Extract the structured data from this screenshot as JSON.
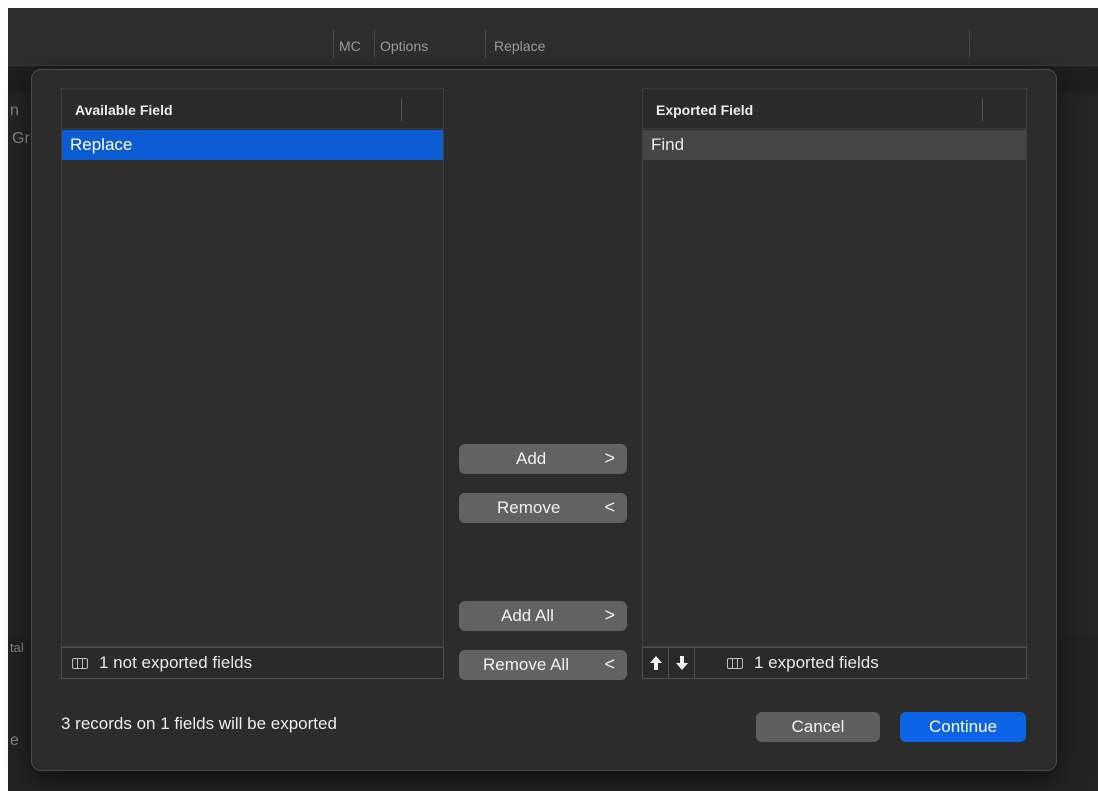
{
  "background": {
    "toolbar_labels": [
      "MC",
      "Options",
      "Replace"
    ],
    "side_fragments": [
      "n",
      "Gr",
      "tal",
      "e"
    ]
  },
  "dialog": {
    "available": {
      "header": "Available Field",
      "rows": [
        "Replace"
      ],
      "footer": "1 not exported fields"
    },
    "exported": {
      "header": "Exported Field",
      "rows": [
        "Find"
      ],
      "footer": "1 exported fields"
    },
    "buttons": {
      "add": "Add",
      "remove": "Remove",
      "add_all": "Add All",
      "remove_all": "Remove All",
      "cancel": "Cancel",
      "continue": "Continue"
    },
    "chevrons": {
      "right": ">",
      "left": "<"
    },
    "status": "3 records on 1 fields will be exported"
  },
  "colors": {
    "selection": "#0b5bd3",
    "primary_button": "#0b63e6"
  },
  "icons": [
    "columns-icon",
    "arrow-up-icon",
    "arrow-down-icon",
    "chevron-right-icon",
    "chevron-left-icon"
  ]
}
